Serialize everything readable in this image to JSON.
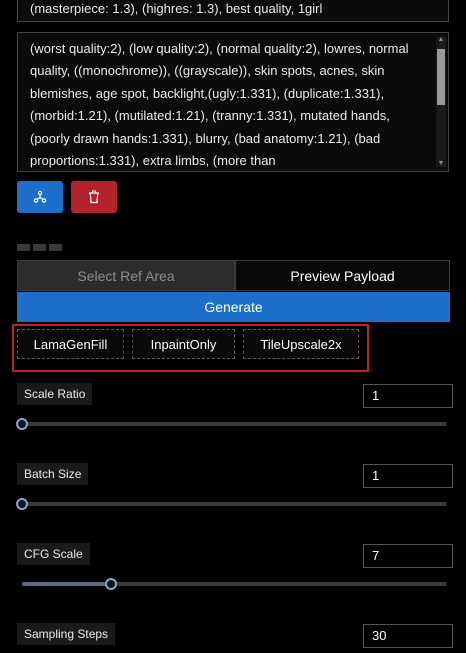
{
  "positive_prompt": {
    "value": "(masterpiece: 1.3), (highres: 1.3), best quality, 1girl"
  },
  "negative_prompt": {
    "value": "(worst quality:2), (low quality:2), (normal quality:2), lowres, normal quality, ((monochrome)), ((grayscale)), skin spots, acnes, skin blemishes, age spot, backlight,(ugly:1.331), (duplicate:1.331), (morbid:1.21), (mutilated:1.21), (tranny:1.331), mutated hands, (poorly drawn hands:1.331), blurry, (bad anatomy:1.21), (bad proportions:1.331), extra limbs, (more than"
  },
  "actions": {
    "share_icon": "share-icon",
    "delete_icon": "trash-icon",
    "accent_blue": "#1e6fc9",
    "danger_red": "#b3232b"
  },
  "mode_tabs": [
    {
      "label": "Select Ref Area"
    },
    {
      "label": "Preview Payload"
    }
  ],
  "generate": {
    "label": "Generate"
  },
  "tools": [
    {
      "label": "LamaGenFill"
    },
    {
      "label": "InpaintOnly"
    },
    {
      "label": "TileUpscale2x"
    }
  ],
  "params": [
    {
      "label": "Scale Ratio",
      "value": "1",
      "slider_fraction": 0.0
    },
    {
      "label": "Batch Size",
      "value": "1",
      "slider_fraction": 0.0
    },
    {
      "label": "CFG Scale",
      "value": "7",
      "slider_fraction": 0.21
    },
    {
      "label": "Sampling Steps",
      "value": "30"
    }
  ]
}
